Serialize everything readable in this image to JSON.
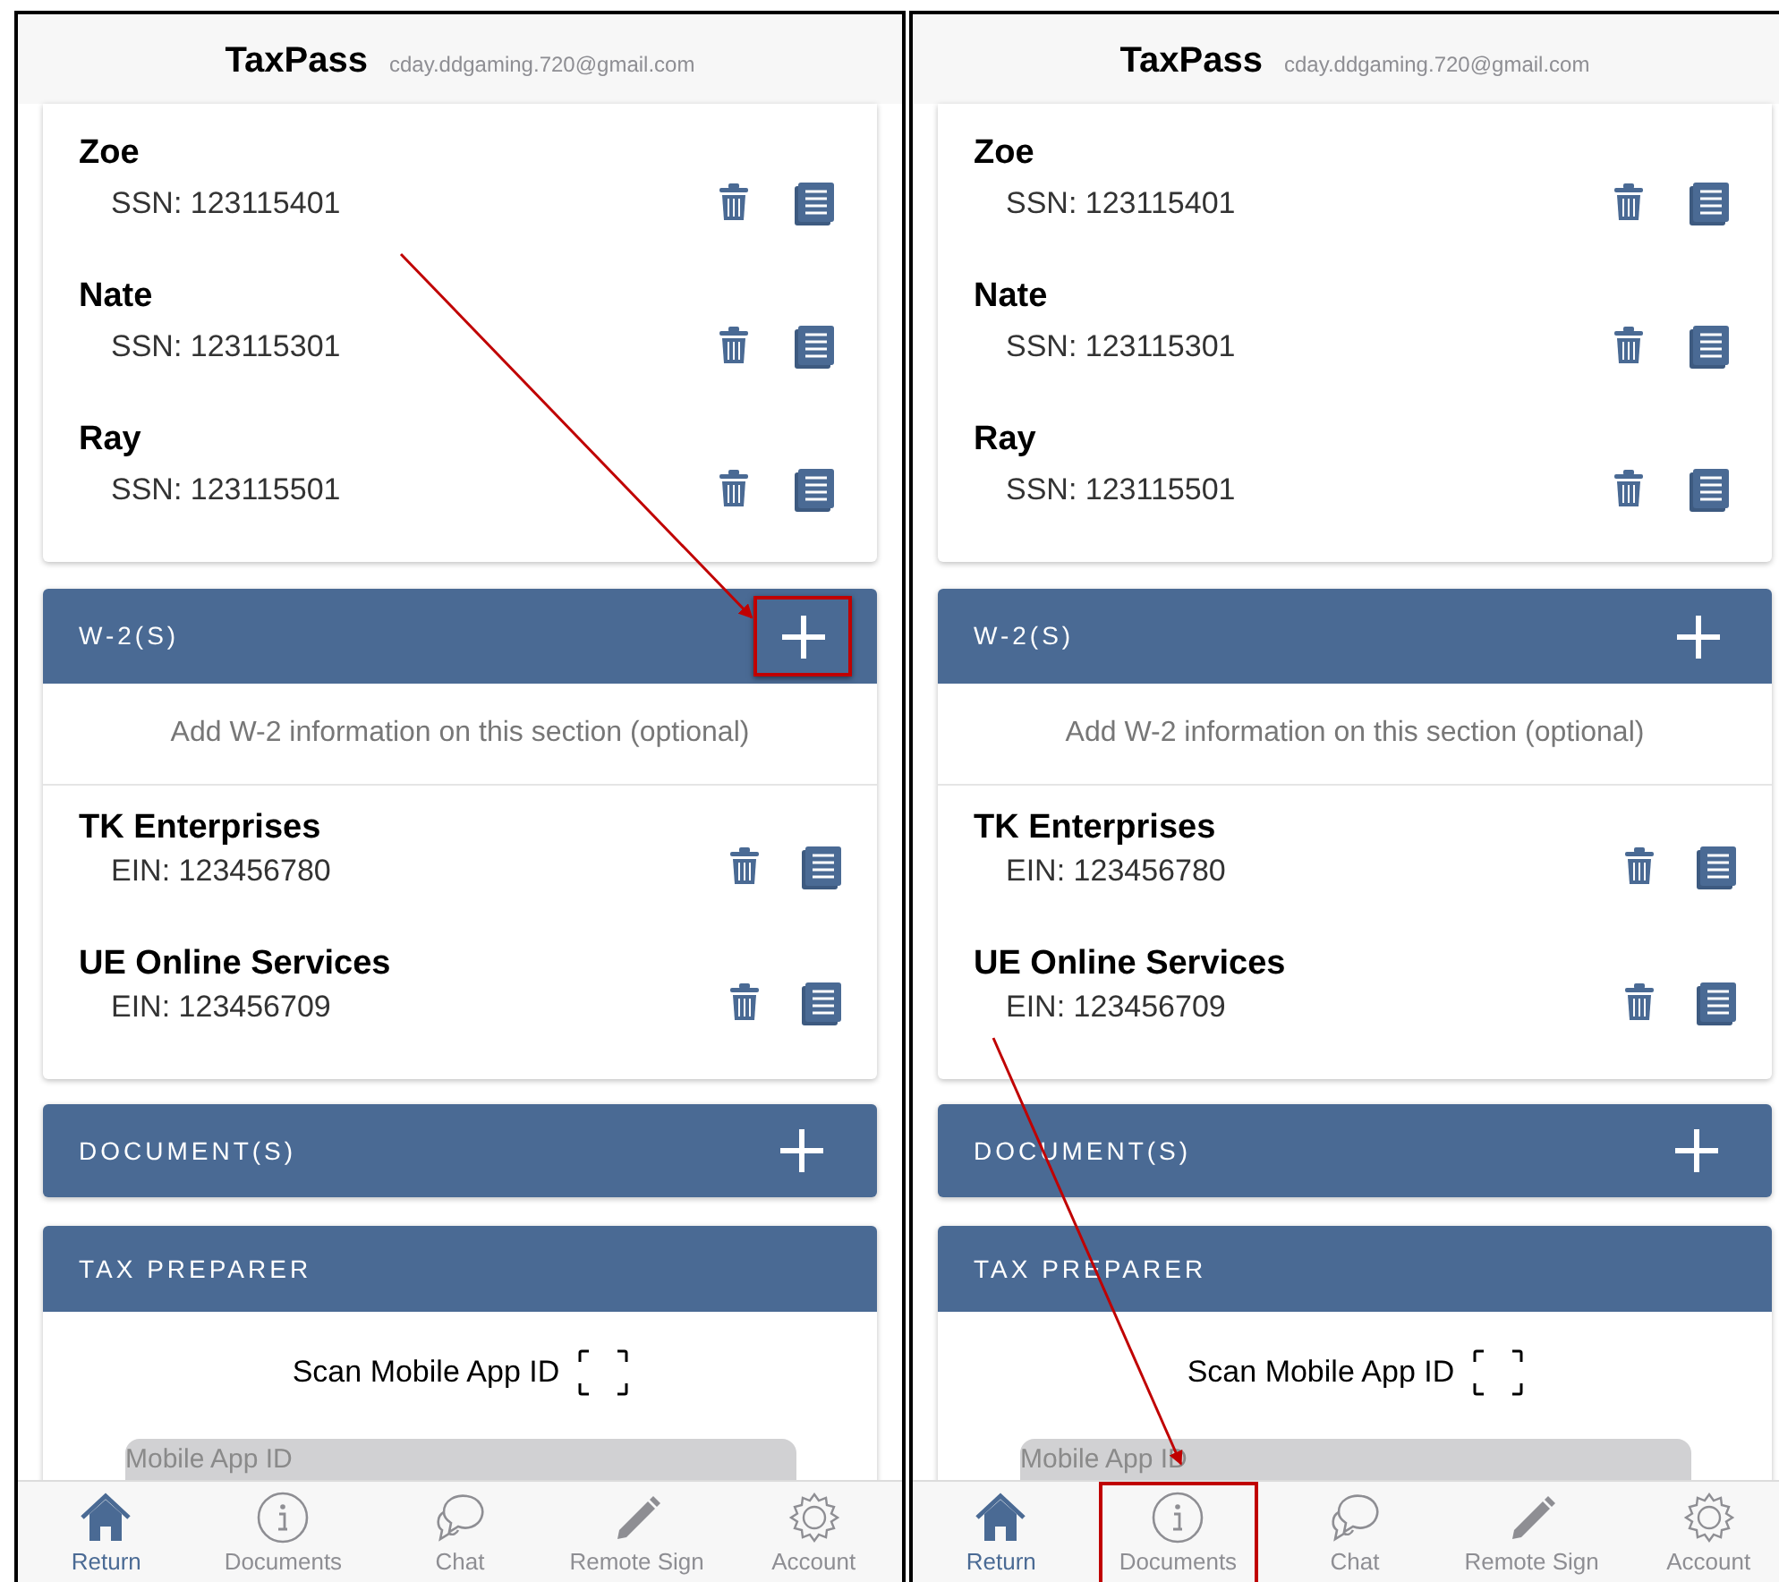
{
  "panels": [
    {
      "header": {
        "app_name": "TaxPass",
        "email": "cday.ddgaming.720@gmail.com"
      },
      "dependents": [
        {
          "name": "Zoe",
          "ssn": "SSN: 123115401"
        },
        {
          "name": "Nate",
          "ssn": "SSN: 123115301"
        },
        {
          "name": "Ray",
          "ssn": "SSN: 123115501"
        }
      ],
      "w2": {
        "title": "W-2(S)",
        "add_highlighted": true,
        "note": "Add W-2 information on this section (optional)",
        "items": [
          {
            "name": "TK Enterprises",
            "ein": "EIN: 123456780"
          },
          {
            "name": "UE Online Services",
            "ein": "EIN: 123456709"
          }
        ]
      },
      "documents": {
        "title": "DOCUMENT(S)"
      },
      "tax_preparer": {
        "title": "TAX PREPARER",
        "scan_label": "Scan Mobile App ID",
        "placeholder": "Mobile App ID"
      },
      "tabs": [
        {
          "label": "Return",
          "selected": true,
          "highlighted": false
        },
        {
          "label": "Documents",
          "selected": false,
          "highlighted": false
        },
        {
          "label": "Chat",
          "selected": false,
          "highlighted": false
        },
        {
          "label": "Remote Sign",
          "selected": false,
          "highlighted": false
        },
        {
          "label": "Account",
          "selected": false,
          "highlighted": false
        }
      ]
    },
    {
      "header": {
        "app_name": "TaxPass",
        "email": "cday.ddgaming.720@gmail.com"
      },
      "dependents": [
        {
          "name": "Zoe",
          "ssn": "SSN: 123115401"
        },
        {
          "name": "Nate",
          "ssn": "SSN: 123115301"
        },
        {
          "name": "Ray",
          "ssn": "SSN: 123115501"
        }
      ],
      "w2": {
        "title": "W-2(S)",
        "add_highlighted": false,
        "note": "Add W-2 information on this section (optional)",
        "items": [
          {
            "name": "TK Enterprises",
            "ein": "EIN: 123456780"
          },
          {
            "name": "UE Online Services",
            "ein": "EIN: 123456709"
          }
        ]
      },
      "documents": {
        "title": "DOCUMENT(S)"
      },
      "tax_preparer": {
        "title": "TAX PREPARER",
        "scan_label": "Scan Mobile App ID",
        "placeholder": "Mobile App ID"
      },
      "tabs": [
        {
          "label": "Return",
          "selected": true,
          "highlighted": false
        },
        {
          "label": "Documents",
          "selected": false,
          "highlighted": true
        },
        {
          "label": "Chat",
          "selected": false,
          "highlighted": false
        },
        {
          "label": "Remote Sign",
          "selected": false,
          "highlighted": false
        },
        {
          "label": "Account",
          "selected": false,
          "highlighted": false
        }
      ]
    }
  ]
}
